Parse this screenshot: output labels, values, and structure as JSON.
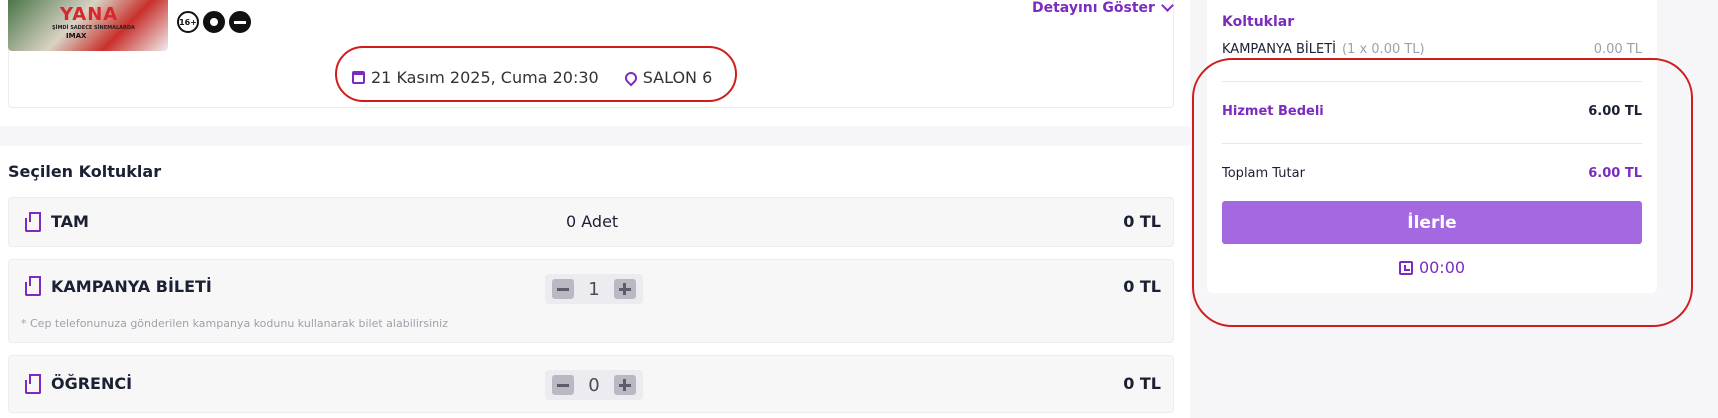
{
  "movie": {
    "poster_title": "YANA",
    "poster_tagline": "ŞİMDİ SADECE SİNEMALARDA",
    "poster_format": "IMAX",
    "ratings": [
      "16+",
      "",
      ""
    ],
    "detail_link_label": "Detayını Göster"
  },
  "session": {
    "date_time": "21 Kasım 2025, Cuma 20:30",
    "hall": "SALON 6"
  },
  "selected_seats": {
    "title": "Seçilen Koltuklar",
    "tickets": [
      {
        "name": "TAM",
        "count_label": "0 Adet",
        "price": "0 TL"
      },
      {
        "name": "KAMPANYA BİLETİ",
        "quantity": "1",
        "price": "0 TL",
        "note": "* Cep telefonunuza gönderilen kampanya kodunu kullanarak bilet alabilirsiniz"
      },
      {
        "name": "ÖĞRENCİ",
        "quantity": "0",
        "price": "0 TL"
      }
    ]
  },
  "summary": {
    "seats_heading": "Koltuklar",
    "line_item_name": "KAMPANYA BİLETİ",
    "line_item_detail": "(1 x 0.00 TL)",
    "line_item_total": "0.00 TL",
    "service_fee_label": "Hizmet Bedeli",
    "service_fee_value": "6.00 TL",
    "total_label": "Toplam Tutar",
    "total_value": "6.00 TL",
    "proceed_label": "İlerle",
    "timer": "00:00"
  },
  "colors": {
    "accent": "#7b2cbf",
    "button": "#a468e1",
    "annotation": "#d21c1c"
  }
}
